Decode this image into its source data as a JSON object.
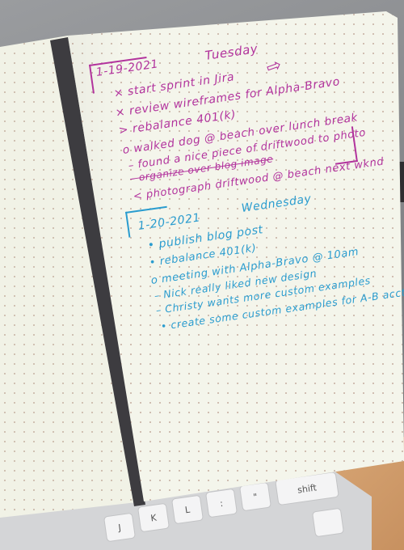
{
  "journal": {
    "day1": {
      "date": "1-19-2021",
      "weekday": "Tuesday",
      "entries": [
        "× start sprint in Jira",
        "× review wireframes for Alpha-Bravo",
        "> rebalance 401(k)",
        "o walked dog @ beach over lunch break",
        "– found a nice piece of driftwood to photo",
        "– organize over blog image",
        "< photograph driftwood @ beach next wknd"
      ],
      "color": "#b2339d"
    },
    "day2": {
      "date": "1-20-2021",
      "weekday": "Wednesday",
      "entries": [
        "• publish blog post",
        "• rebalance 401(k)",
        "o meeting with Alpha-Bravo @ 10am",
        "– Nick really liked new design",
        "– Christy wants more custom examples",
        "• create some custom examples for A-B acct."
      ],
      "color": "#2a9ccf"
    }
  },
  "keyboard": {
    "keys": [
      "J",
      "K",
      "L",
      ":",
      "\"",
      "shift"
    ]
  }
}
